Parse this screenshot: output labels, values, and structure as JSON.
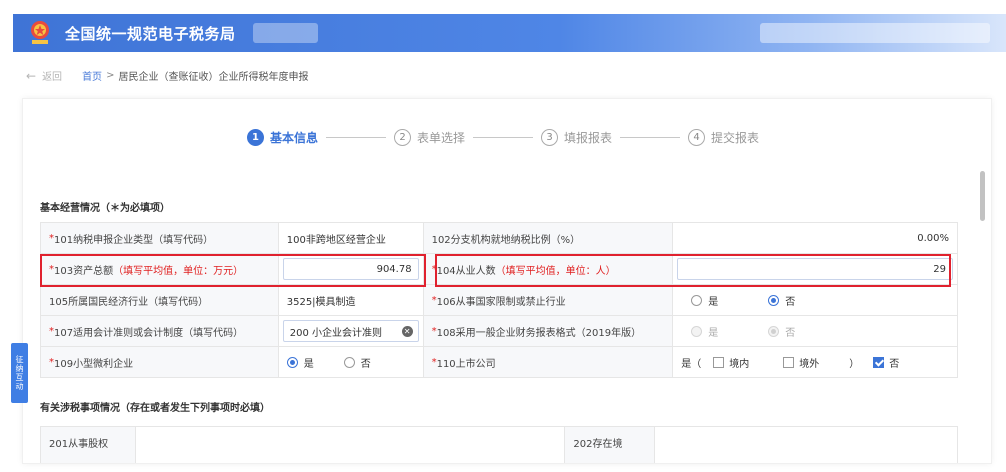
{
  "header": {
    "title": "全国统一规范电子税务局"
  },
  "breadcrumb": {
    "back_label": "返回",
    "home": "首页",
    "separator": ">",
    "current": "居民企业（查账征收）企业所得税年度申报"
  },
  "steps": [
    {
      "num": "1",
      "label": "基本信息"
    },
    {
      "num": "2",
      "label": "表单选择"
    },
    {
      "num": "3",
      "label": "填报报表"
    },
    {
      "num": "4",
      "label": "提交报表"
    }
  ],
  "section1": {
    "title": "基本经营情况（＊为必填项）"
  },
  "rows": [
    {
      "l1": "101纳税申报企业类型（填写代码）",
      "v1": "100非跨地区经营企业",
      "l2": "102分支机构就地纳税比例（%）",
      "v2": "0.00%"
    },
    {
      "l1": "103资产总额",
      "h1": "（填写平均值，单位：万元）",
      "v1": "904.78",
      "l2": "104从业人数",
      "h2": "（填写平均值，单位：人）",
      "v2": "29"
    },
    {
      "l1": "105所属国民经济行业（填写代码）",
      "v1": "3525|模具制造",
      "l2": "106从事国家限制或禁止行业",
      "opt_yes": "是",
      "opt_no": "否"
    },
    {
      "l1": "107适用会计准则或会计制度（填写代码）",
      "v1": "200 小企业会计准则",
      "l2": "108采用一般企业财务报表格式（2019年版）",
      "opt_yes": "是",
      "opt_no": "否"
    },
    {
      "l1": "109小型微利企业",
      "opt_yes": "是",
      "opt_no": "否",
      "l2": "110上市公司",
      "prefix": "是（",
      "chk1": "境内",
      "chk2": "境外",
      "suffix": "）",
      "chk3": "否"
    }
  ],
  "required_mark": "*",
  "section2": {
    "title": "有关涉税事项情况（存在或者发生下列事项时必填）"
  },
  "section2_rows": {
    "c1": "201从事股权",
    "c2": "202存在境"
  },
  "side_tab": {
    "label": "征纳互动"
  },
  "colors": {
    "primary": "#3b74d7",
    "highlight": "#e0212e",
    "required": "#e02020"
  }
}
